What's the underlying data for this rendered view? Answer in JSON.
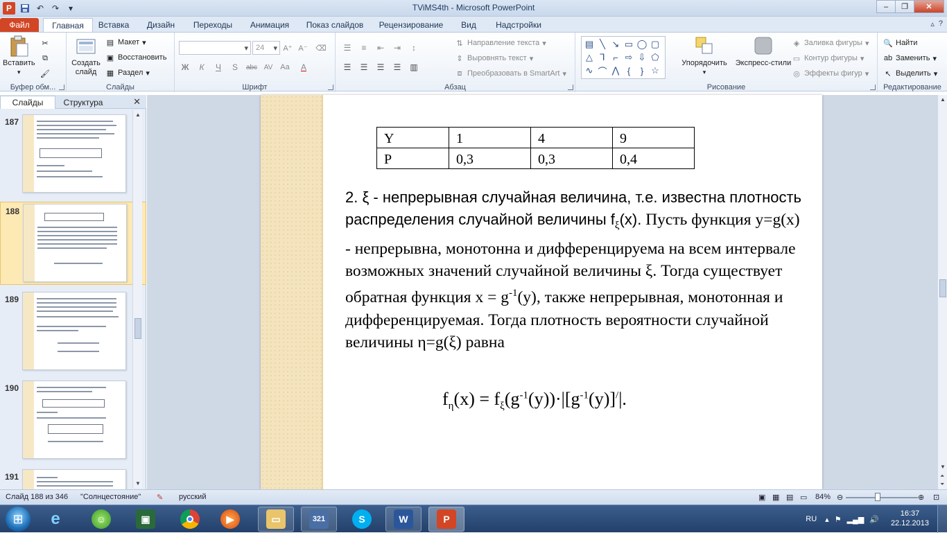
{
  "titlebar": {
    "title": "TViMS4th  -  Microsoft PowerPoint",
    "app_icon": "P",
    "controls": [
      "–",
      "❐",
      "✕"
    ]
  },
  "tabs": [
    {
      "label": "Файл"
    },
    {
      "label": "Главная"
    },
    {
      "label": "Вставка"
    },
    {
      "label": "Дизайн"
    },
    {
      "label": "Переходы"
    },
    {
      "label": "Анимация"
    },
    {
      "label": "Показ слайдов"
    },
    {
      "label": "Рецензирование"
    },
    {
      "label": "Вид"
    },
    {
      "label": "Надстройки"
    }
  ],
  "ribbon": {
    "clipboard": {
      "paste": "Вставить",
      "label": "Буфер обм..."
    },
    "slides": {
      "new_slide": "Создать\nслайд",
      "layout": "Макет",
      "reset": "Восстановить",
      "section": "Раздел",
      "label": "Слайды"
    },
    "font": {
      "size": "24",
      "label": "Шрифт",
      "buttons": [
        "Ж",
        "К",
        "Ч",
        "S",
        "abc",
        "AV",
        "Aa",
        "A"
      ]
    },
    "paragraph": {
      "text_direction": "Направление текста",
      "align_text": "Выровнять текст",
      "smartart": "Преобразовать в SmartArt",
      "label": "Абзац"
    },
    "drawing": {
      "arrange": "Упорядочить",
      "quick_styles": "Экспресс-стили",
      "fill": "Заливка фигуры",
      "outline": "Контур фигуры",
      "effects": "Эффекты фигур",
      "label": "Рисование"
    },
    "editing": {
      "find": "Найти",
      "replace": "Заменить",
      "select": "Выделить",
      "label": "Редактирование"
    }
  },
  "panel": {
    "tabs": [
      "Слайды",
      "Структура"
    ],
    "thumbnails": [
      {
        "num": "187"
      },
      {
        "num": "188"
      },
      {
        "num": "189"
      },
      {
        "num": "190"
      },
      {
        "num": "191"
      }
    ]
  },
  "slide": {
    "table": {
      "rows": [
        [
          "Y",
          "1",
          "4",
          "9"
        ],
        [
          "P",
          "0,3",
          "0,3",
          "0,4"
        ]
      ]
    },
    "p1": "2. ξ - непрерывная случайная величина, т.е. известна плотность распределения случайной величины f",
    "p1_sub": "ξ",
    "p1_end": "(x).",
    "p2a": "Пусть функция y=g(x) - непрерывна, монотонна и дифференцируема на всем интервале возможных значений случайной величины  ξ. Тогда существует обратная функция  x =  g",
    "p2_sup": "-1",
    "p2b": "(y), также непрерывная, монотонная и дифференцируемая. Тогда плотность вероятности случайной величины  η=g(ξ) равна",
    "formula": {
      "f": "f",
      "sub_eta": "η",
      "a": "(x) = f",
      "sub_xi": "ξ",
      "b": "(g",
      "sup1": "-1",
      "c": "(y))·|[g",
      "sup2": "-1",
      "d": "(y)]",
      "sup3": "/",
      "e": "|."
    }
  },
  "statusbar": {
    "slide_info": "Слайд 188 из 346",
    "theme": "\"Солнцестояние\"",
    "language": "русский",
    "zoom": "84%"
  },
  "taskbar": {
    "lang": "RU",
    "time": "16:37",
    "date": "22.12.2013"
  }
}
